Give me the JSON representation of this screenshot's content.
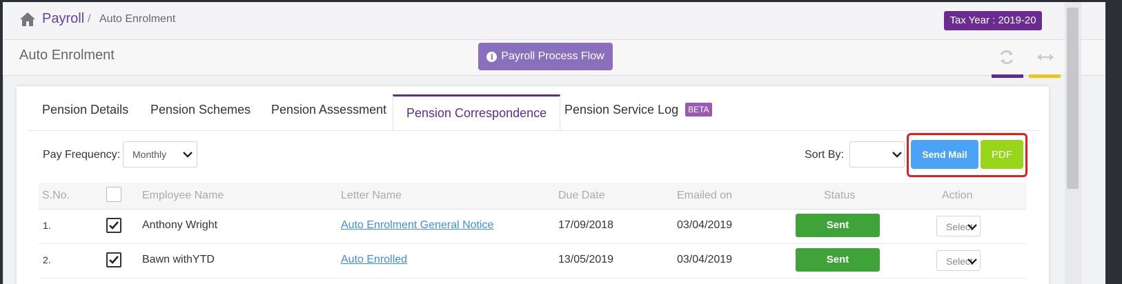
{
  "breadcrumb": {
    "home_icon": "home-icon",
    "root": "Payroll",
    "separator": "/",
    "current": "Auto Enrolment"
  },
  "tax_year_badge": "Tax Year : 2019-20",
  "page": {
    "title": "Auto Enrolment",
    "flow_button": "Payroll Process Flow",
    "tools": [
      "refresh-icon",
      "expand-icon"
    ]
  },
  "tabs": [
    {
      "label": "Pension Details"
    },
    {
      "label": "Pension Schemes"
    },
    {
      "label": "Pension Assessment"
    },
    {
      "label": "Pension Correspondence",
      "active": true
    },
    {
      "label": "Pension Service Log",
      "badge": "BETA"
    }
  ],
  "filters": {
    "pay_frequency_label": "Pay Frequency:",
    "pay_frequency_value": "Monthly",
    "sort_by_label": "Sort By:",
    "sort_by_value": ""
  },
  "actions": {
    "send_mail": "Send Mail",
    "pdf": "PDF"
  },
  "table": {
    "columns": [
      "S.No.",
      "",
      "Employee Name",
      "Letter Name",
      "Due Date",
      "Emailed on",
      "Status",
      "Action"
    ],
    "rows": [
      {
        "sno": "1.",
        "checked": true,
        "employee": "Anthony Wright",
        "letter": "Auto Enrolment General Notice",
        "due": "17/09/2018",
        "emailed": "03/04/2019",
        "status": "Sent",
        "action": "Select"
      },
      {
        "sno": "2.",
        "checked": true,
        "employee": "Bawn withYTD",
        "letter": "Auto Enrolled",
        "due": "13/05/2019",
        "emailed": "03/04/2019",
        "status": "Sent",
        "action": "Select"
      }
    ]
  },
  "colors": {
    "brand_purple": "#5b2d8e",
    "tax_badge": "#6b2c91",
    "flow_button": "#8a6fbd",
    "send_mail": "#4aa3f5",
    "pdf": "#97d61a",
    "status_sent": "#3fa33a",
    "highlight_border": "#e51d1d",
    "link": "#3d8fe0"
  }
}
